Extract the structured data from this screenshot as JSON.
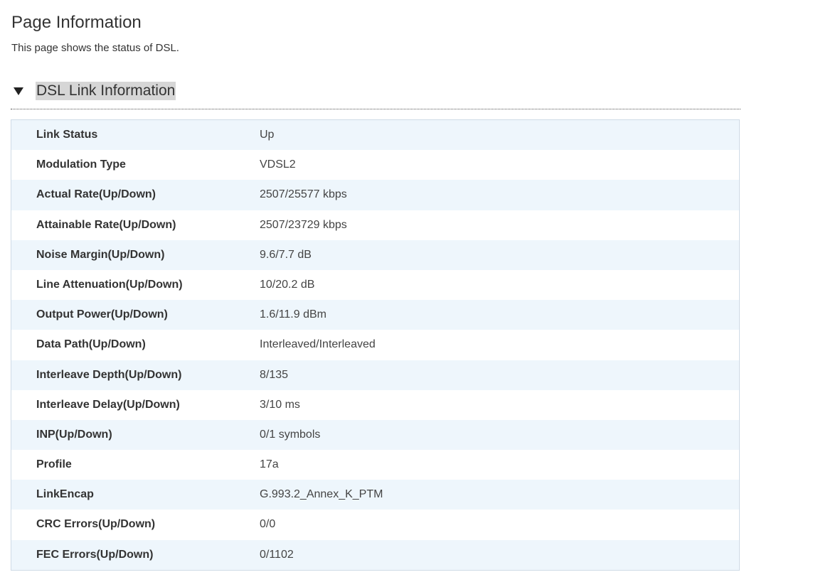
{
  "page": {
    "title": "Page Information",
    "description": "This page shows the status of DSL."
  },
  "section": {
    "title": "DSL Link Information",
    "toggle_icon": "triangle-down-icon"
  },
  "rows": [
    {
      "label": "Link Status",
      "value": "Up"
    },
    {
      "label": "Modulation Type",
      "value": "VDSL2"
    },
    {
      "label": "Actual Rate(Up/Down)",
      "value": "2507/25577 kbps"
    },
    {
      "label": "Attainable Rate(Up/Down)",
      "value": "2507/23729 kbps"
    },
    {
      "label": "Noise Margin(Up/Down)",
      "value": "9.6/7.7 dB"
    },
    {
      "label": "Line Attenuation(Up/Down)",
      "value": "10/20.2 dB"
    },
    {
      "label": "Output Power(Up/Down)",
      "value": "1.6/11.9 dBm"
    },
    {
      "label": "Data Path(Up/Down)",
      "value": "Interleaved/Interleaved"
    },
    {
      "label": "Interleave Depth(Up/Down)",
      "value": "8/135"
    },
    {
      "label": "Interleave Delay(Up/Down)",
      "value": "3/10 ms"
    },
    {
      "label": "INP(Up/Down)",
      "value": "0/1 symbols"
    },
    {
      "label": "Profile",
      "value": "17a"
    },
    {
      "label": "LinkEncap",
      "value": "G.993.2_Annex_K_PTM"
    },
    {
      "label": "CRC Errors(Up/Down)",
      "value": "0/0"
    },
    {
      "label": "FEC Errors(Up/Down)",
      "value": "0/1102"
    }
  ],
  "colors": {
    "row_alt": "#eef6fc",
    "row": "#ffffff",
    "table_border": "#cfdbe6",
    "section_title_bg": "#d6d6d6"
  }
}
